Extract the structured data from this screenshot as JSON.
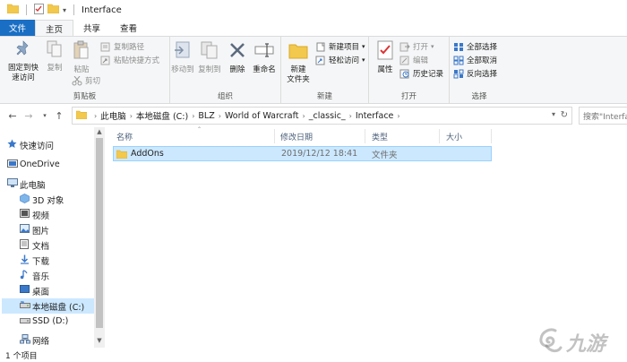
{
  "window": {
    "title": "Interface"
  },
  "tabs": [
    {
      "label": "文件"
    },
    {
      "label": "主页"
    },
    {
      "label": "共享"
    },
    {
      "label": "查看"
    }
  ],
  "ribbon": {
    "clipboard": {
      "pin_label_1": "固定到快",
      "pin_label_2": "速访问",
      "copy_label": "复制",
      "paste_label": "粘贴",
      "copy_path_label": "复制路径",
      "paste_shortcut_label": "粘贴快捷方式",
      "cut_label": "剪切",
      "group_label": "剪贴板"
    },
    "organize": {
      "move_to_label": "移动到",
      "copy_to_label": "复制到",
      "delete_label": "删除",
      "rename_label": "重命名",
      "group_label": "组织"
    },
    "new": {
      "new_folder_label_1": "新建",
      "new_folder_label_2": "文件夹",
      "new_item_label": "新建项目",
      "easy_access_label": "轻松访问",
      "group_label": "新建"
    },
    "open": {
      "properties_label": "属性",
      "open_label": "打开",
      "edit_label": "编辑",
      "history_label": "历史记录",
      "group_label": "打开"
    },
    "select": {
      "select_all_label": "全部选择",
      "select_none_label": "全部取消",
      "invert_label": "反向选择",
      "group_label": "选择"
    }
  },
  "address": {
    "crumbs": [
      "此电脑",
      "本地磁盘 (C:)",
      "BLZ",
      "World of Warcraft",
      "_classic_",
      "Interface"
    ],
    "search_placeholder": "搜索\"Interface\""
  },
  "nav_pane": {
    "items": [
      {
        "label": "快速访问",
        "icon": "star-icon"
      },
      {
        "label": "OneDrive",
        "icon": "cloud-icon"
      },
      {
        "label": "此电脑",
        "icon": "computer-icon"
      },
      {
        "label": "3D 对象",
        "icon": "cube-icon"
      },
      {
        "label": "视频",
        "icon": "video-icon"
      },
      {
        "label": "图片",
        "icon": "picture-icon"
      },
      {
        "label": "文档",
        "icon": "document-icon"
      },
      {
        "label": "下载",
        "icon": "download-icon"
      },
      {
        "label": "音乐",
        "icon": "music-icon"
      },
      {
        "label": "桌面",
        "icon": "desktop-icon"
      },
      {
        "label": "本地磁盘 (C:)",
        "icon": "drive-icon"
      },
      {
        "label": "SSD (D:)",
        "icon": "drive-icon"
      },
      {
        "label": "网络",
        "icon": "network-icon"
      }
    ]
  },
  "columns": {
    "name": "名称",
    "modified": "修改日期",
    "type": "类型",
    "size": "大小"
  },
  "files": [
    {
      "name": "AddOns",
      "modified": "2019/12/12 18:41",
      "type": "文件夹",
      "size": ""
    }
  ],
  "status": {
    "count": "1 个项目"
  },
  "watermark": {
    "text": "九游"
  },
  "colors": {
    "accent": "#1a6fc4",
    "folder": "#f2c94c",
    "selection": "#cce8ff",
    "selection_border": "#99d1ff"
  }
}
